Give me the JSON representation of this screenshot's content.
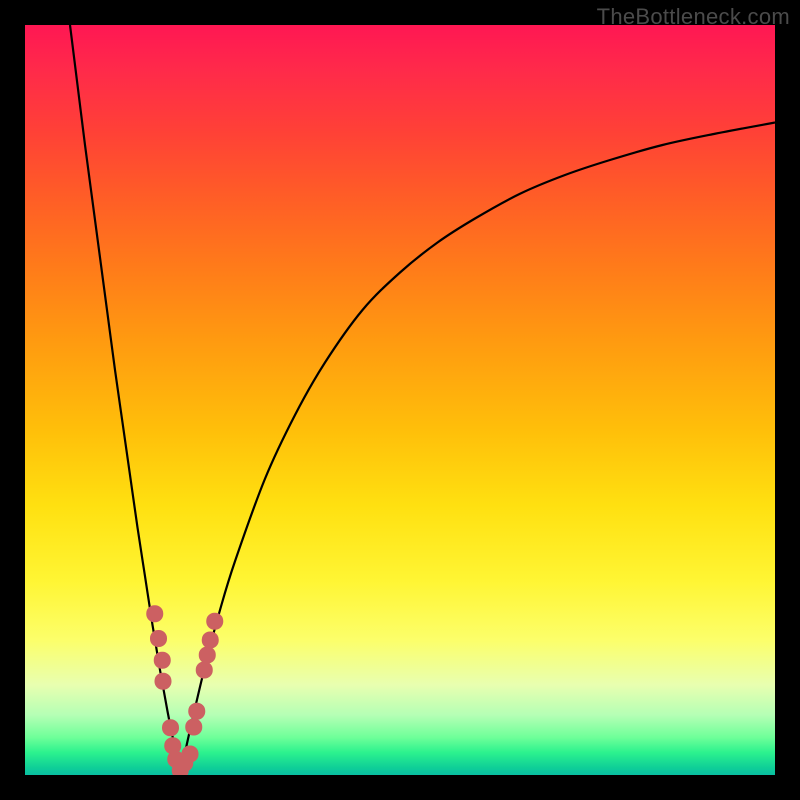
{
  "watermark": "TheBottleneck.com",
  "colors": {
    "frame": "#000000",
    "gradient_top": "#ff1753",
    "gradient_mid": "#ffe010",
    "gradient_bottom": "#09bfa2",
    "curve_stroke": "#000000",
    "marker_fill": "#cc6062",
    "marker_stroke": "#cc6062"
  },
  "chart_data": {
    "type": "line",
    "title": "",
    "xlabel": "",
    "ylabel": "",
    "xlim": [
      0,
      100
    ],
    "ylim": [
      0,
      100
    ],
    "grid": false,
    "legend": false,
    "series": [
      {
        "name": "left-branch",
        "x": [
          6.0,
          7.0,
          8.0,
          9.0,
          10.0,
          11.0,
          12.0,
          13.0,
          14.0,
          15.0,
          16.0,
          17.0,
          18.0,
          19.0,
          20.0,
          20.7
        ],
        "y": [
          100.0,
          92.0,
          84.0,
          76.5,
          69.0,
          61.5,
          54.0,
          47.0,
          40.0,
          33.0,
          26.5,
          20.0,
          14.0,
          8.5,
          3.5,
          0.0
        ]
      },
      {
        "name": "right-branch",
        "x": [
          20.7,
          22.0,
          24.0,
          26.0,
          28.0,
          32.0,
          36.0,
          40.0,
          45.0,
          50.0,
          55.0,
          60.0,
          66.0,
          72.0,
          78.0,
          85.0,
          92.0,
          100.0
        ],
        "y": [
          0.0,
          6.0,
          14.5,
          22.0,
          28.5,
          39.5,
          48.0,
          55.0,
          62.0,
          67.0,
          71.0,
          74.2,
          77.5,
          80.0,
          82.0,
          84.0,
          85.5,
          87.0
        ]
      }
    ],
    "markers": [
      {
        "x": 17.3,
        "y": 21.5
      },
      {
        "x": 17.8,
        "y": 18.2
      },
      {
        "x": 18.3,
        "y": 15.3
      },
      {
        "x": 18.4,
        "y": 12.5
      },
      {
        "x": 19.4,
        "y": 6.3
      },
      {
        "x": 19.7,
        "y": 3.9
      },
      {
        "x": 20.1,
        "y": 2.1
      },
      {
        "x": 20.7,
        "y": 0.6
      },
      {
        "x": 21.3,
        "y": 1.6
      },
      {
        "x": 22.0,
        "y": 2.8
      },
      {
        "x": 22.5,
        "y": 6.4
      },
      {
        "x": 22.9,
        "y": 8.5
      },
      {
        "x": 23.9,
        "y": 14.0
      },
      {
        "x": 24.3,
        "y": 16.0
      },
      {
        "x": 24.7,
        "y": 18.0
      },
      {
        "x": 25.3,
        "y": 20.5
      }
    ],
    "marker_radius_px": 8
  }
}
